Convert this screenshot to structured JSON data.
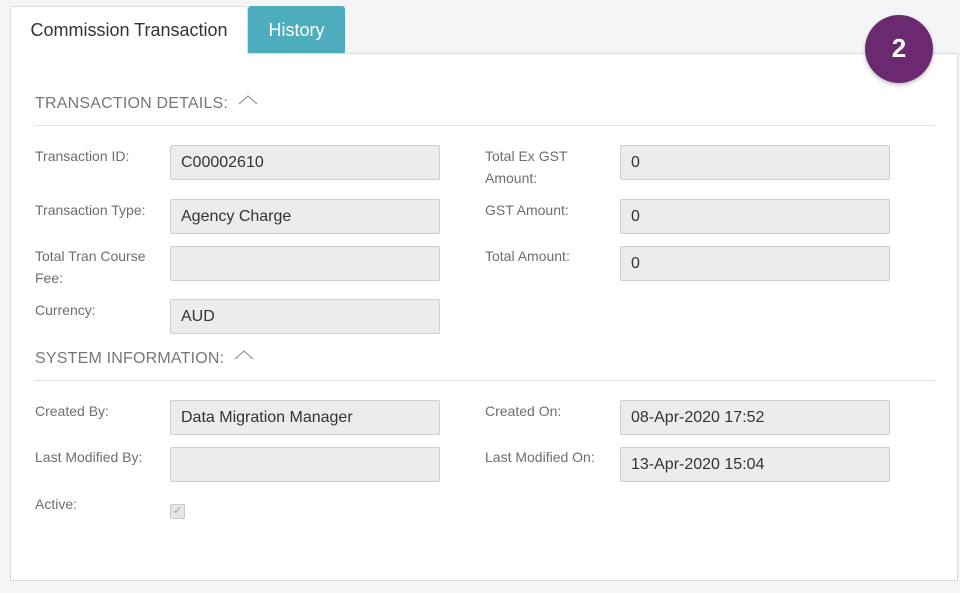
{
  "tabs": [
    {
      "label": "Commission Transaction",
      "active": true
    },
    {
      "label": "History",
      "active": false
    }
  ],
  "badge": "2",
  "transaction_details": {
    "title": "TRANSACTION DETAILS:",
    "fields": {
      "transaction_id": {
        "label": "Transaction ID:",
        "value": "C00002610"
      },
      "transaction_type": {
        "label": "Transaction Type:",
        "value": "Agency Charge"
      },
      "total_tran_course_fee": {
        "label": "Total Tran Course Fee:",
        "value": ""
      },
      "currency": {
        "label": "Currency:",
        "value": "AUD"
      },
      "total_ex_gst_amount": {
        "label": "Total Ex GST Amount:",
        "value": "0"
      },
      "gst_amount": {
        "label": "GST Amount:",
        "value": "0"
      },
      "total_amount": {
        "label": "Total Amount:",
        "value": "0"
      }
    }
  },
  "system_information": {
    "title": "SYSTEM INFORMATION:",
    "fields": {
      "created_by": {
        "label": "Created By:",
        "value": "Data Migration Manager"
      },
      "last_modified_by": {
        "label": "Last Modified By:",
        "value": ""
      },
      "active": {
        "label": "Active:",
        "checked": true
      },
      "created_on": {
        "label": "Created On:",
        "value": "08-Apr-2020 17:52"
      },
      "last_modified_on": {
        "label": "Last Modified On:",
        "value": "13-Apr-2020 15:04"
      }
    }
  },
  "icons": {
    "collapse": "chevron-up-icon",
    "checkbox": "checkmark-icon"
  },
  "colors": {
    "tab_inactive_bg": "#4eadbd",
    "badge_bg": "#6b2a6f",
    "field_bg": "#ececec"
  }
}
